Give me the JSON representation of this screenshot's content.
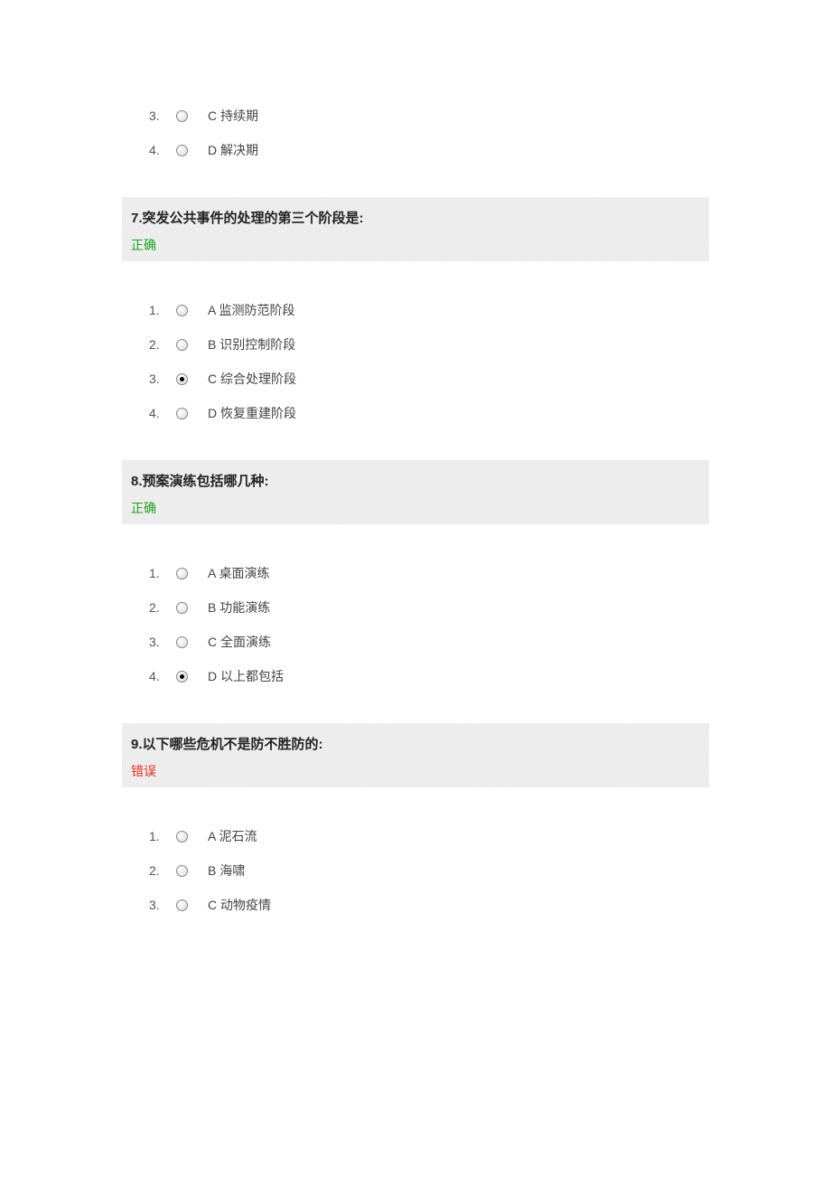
{
  "partial_question_options": [
    {
      "num": "3.",
      "label": "C 持续期",
      "checked": false
    },
    {
      "num": "4.",
      "label": "D 解决期",
      "checked": false
    }
  ],
  "questions": [
    {
      "title": "7.突发公共事件的处理的第三个阶段是:",
      "status_text": "正确",
      "status_class": "status-correct",
      "options": [
        {
          "num": "1.",
          "label": "A 监测防范阶段",
          "checked": false
        },
        {
          "num": "2.",
          "label": "B 识别控制阶段",
          "checked": false
        },
        {
          "num": "3.",
          "label": "C 综合处理阶段",
          "checked": true
        },
        {
          "num": "4.",
          "label": "D 恢复重建阶段",
          "checked": false
        }
      ]
    },
    {
      "title": "8.预案演练包括哪几种:",
      "status_text": "正确",
      "status_class": "status-correct",
      "options": [
        {
          "num": "1.",
          "label": "A 桌面演练",
          "checked": false
        },
        {
          "num": "2.",
          "label": "B 功能演练",
          "checked": false
        },
        {
          "num": "3.",
          "label": "C 全面演练",
          "checked": false
        },
        {
          "num": "4.",
          "label": "D 以上都包括",
          "checked": true
        }
      ]
    },
    {
      "title": "9.以下哪些危机不是防不胜防的:",
      "status_text": "错误",
      "status_class": "status-wrong",
      "options": [
        {
          "num": "1.",
          "label": "A 泥石流",
          "checked": false
        },
        {
          "num": "2.",
          "label": "B 海啸",
          "checked": false
        },
        {
          "num": "3.",
          "label": "C 动物疫情",
          "checked": false
        }
      ]
    }
  ]
}
